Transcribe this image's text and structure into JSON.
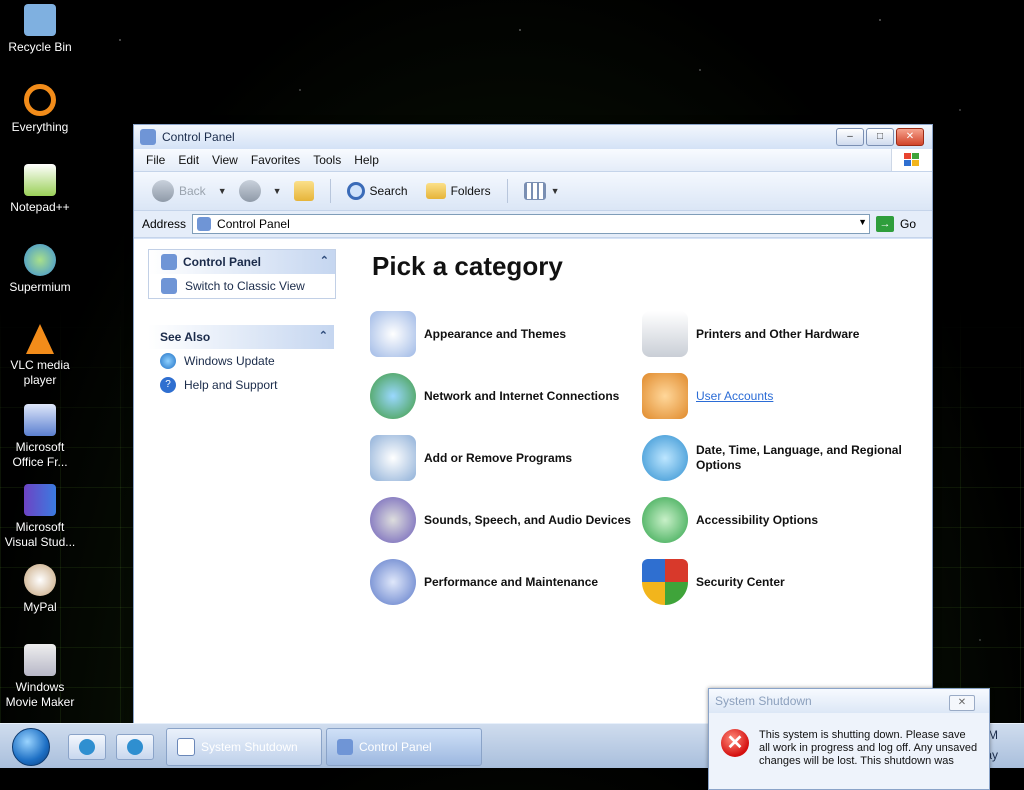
{
  "desktop": {
    "icons": [
      {
        "label": "Recycle Bin",
        "icon": "recycle-bin-icon",
        "color": "#7fb0e0"
      },
      {
        "label": "Everything",
        "icon": "everything-search-icon",
        "color": "#f28c1a"
      },
      {
        "label": "Notepad++",
        "icon": "notepad-plus-plus-icon",
        "color": "#9ad058"
      },
      {
        "label": "Supermium",
        "icon": "supermium-browser-icon",
        "color": "#3a8fd8"
      },
      {
        "label": "VLC media player",
        "icon": "vlc-cone-icon",
        "color": "#f28c1a"
      },
      {
        "label": "Microsoft Office Fr...",
        "icon": "office-frontpage-icon",
        "color": "#5b7fd0"
      },
      {
        "label": "Microsoft Visual Stud...",
        "icon": "visual-studio-icon",
        "color": "#6d44c4"
      },
      {
        "label": "MyPal",
        "icon": "mypal-icon",
        "color": "#c5a37a"
      },
      {
        "label": "Windows Movie Maker",
        "icon": "movie-maker-icon",
        "color": "#b7b7c7"
      }
    ]
  },
  "window": {
    "title": "Control Panel",
    "menu": [
      "File",
      "Edit",
      "View",
      "Favorites",
      "Tools",
      "Help"
    ],
    "toolbar": {
      "back": "Back",
      "search": "Search",
      "folders": "Folders"
    },
    "address": {
      "label": "Address",
      "value": "Control Panel",
      "go": "Go"
    },
    "sidebar": {
      "panel1": {
        "title": "Control Panel",
        "link": "Switch to Classic View"
      },
      "panel2": {
        "title": "See Also",
        "links": [
          "Windows Update",
          "Help and Support"
        ]
      }
    },
    "main": {
      "heading": "Pick a category",
      "categories": [
        {
          "label": "Appearance and Themes",
          "icon": "appearance-themes-icon",
          "color": "#9fb9e6"
        },
        {
          "label": "Printers and Other Hardware",
          "icon": "printer-icon",
          "color": "#c9ced6"
        },
        {
          "label": "Network and Internet Connections",
          "icon": "network-globe-icon",
          "color": "#3f9a3c"
        },
        {
          "label": "User Accounts",
          "icon": "user-accounts-icon",
          "color": "#e08a2c"
        },
        {
          "label": "Add or Remove Programs",
          "icon": "add-remove-programs-icon",
          "color": "#8fb0d8"
        },
        {
          "label": "Date, Time, Language, and Regional Options",
          "icon": "date-time-globe-icon",
          "color": "#2f8fd0"
        },
        {
          "label": "Sounds, Speech, and Audio Devices",
          "icon": "sounds-speaker-icon",
          "color": "#6a5bb8"
        },
        {
          "label": "Accessibility Options",
          "icon": "accessibility-icon",
          "color": "#2fa34a"
        },
        {
          "label": "Performance and Maintenance",
          "icon": "performance-chart-icon",
          "color": "#5a78c8"
        },
        {
          "label": "Security Center",
          "icon": "security-shield-icon",
          "color": "#d8392b"
        }
      ]
    }
  },
  "taskbar": {
    "tasks": [
      "System Shutdown",
      "Control Panel"
    ],
    "clock": "M",
    "clock2": "ay"
  },
  "dialog": {
    "title": "System Shutdown",
    "message": "This system is shutting down. Please save all work in progress and log off. Any unsaved changes will be lost. This shutdown was"
  }
}
